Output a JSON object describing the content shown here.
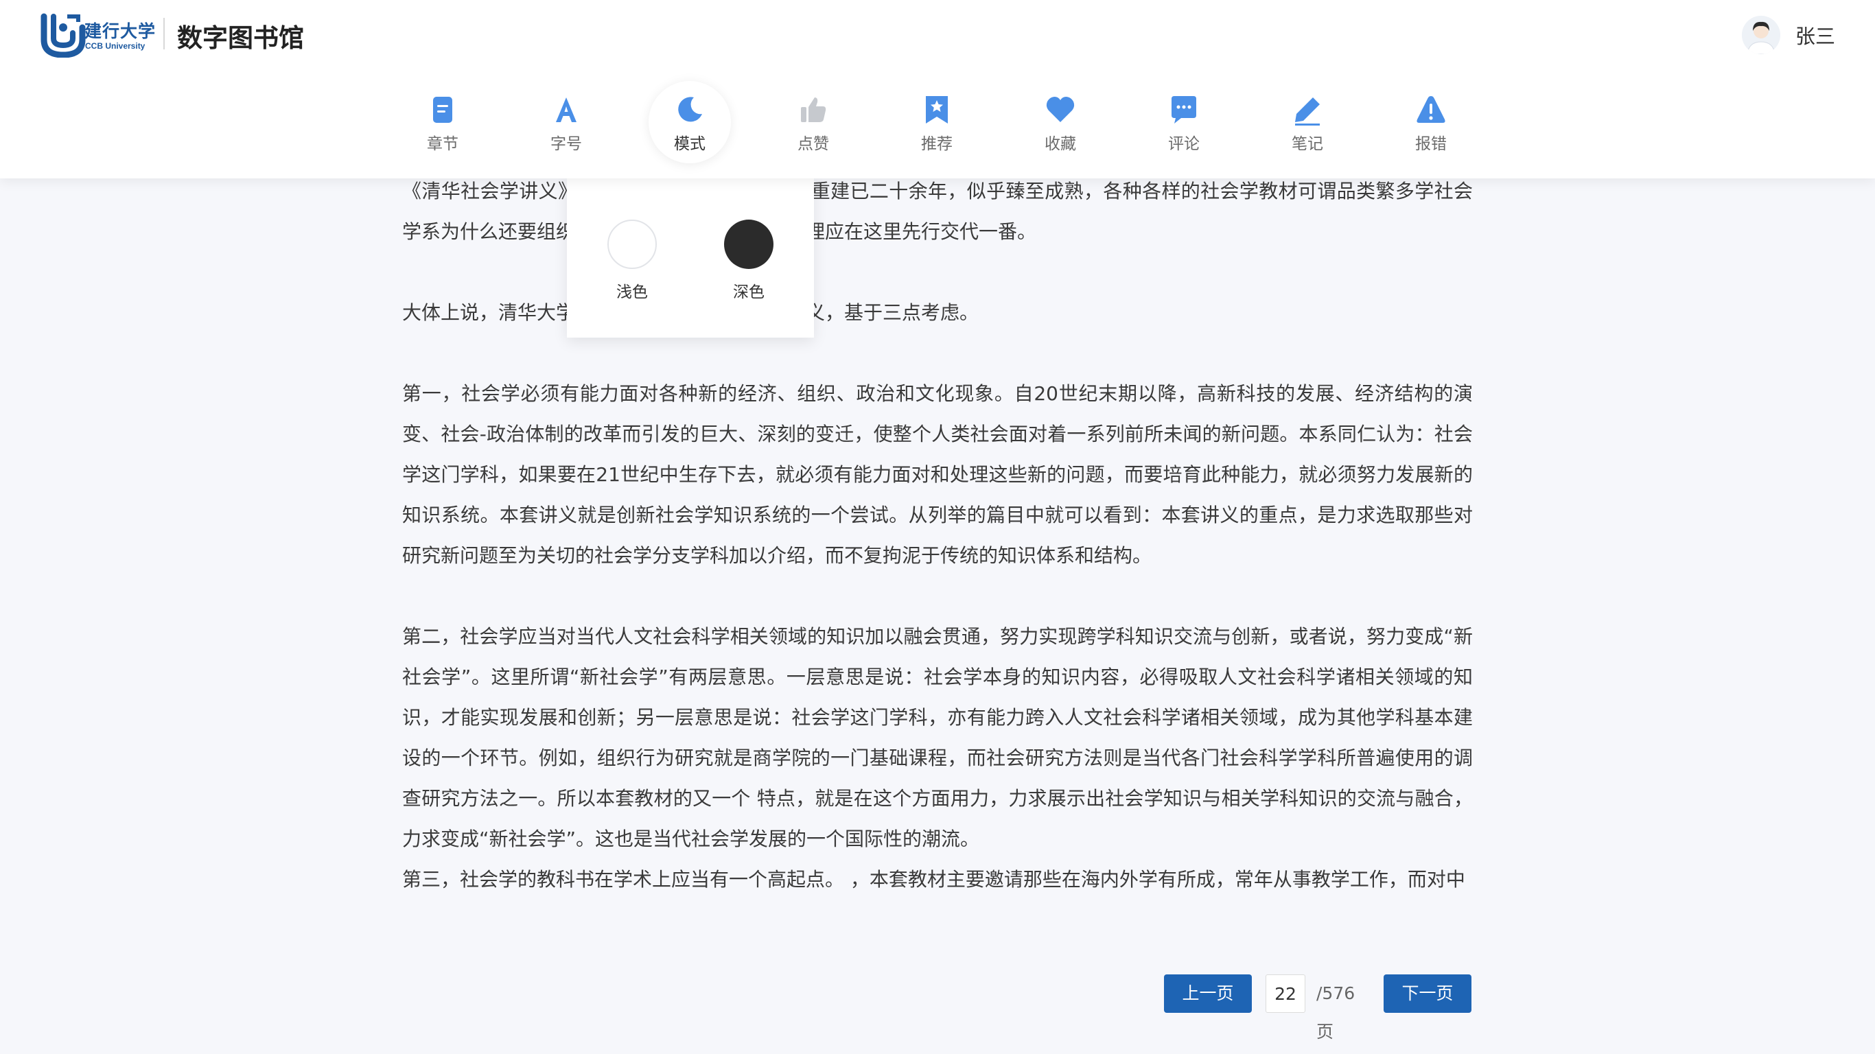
{
  "brand": {
    "logo_cn": "建行大学",
    "logo_en": "CCB University",
    "site_title": "数字图书馆"
  },
  "user": {
    "name": "张三"
  },
  "toolbar": {
    "items": [
      {
        "label": "章节",
        "icon": "chapter-icon"
      },
      {
        "label": "字号",
        "icon": "font-size-icon"
      },
      {
        "label": "模式",
        "icon": "moon-icon",
        "active": true
      },
      {
        "label": "点赞",
        "icon": "thumbs-up-icon"
      },
      {
        "label": "推荐",
        "icon": "bookmark-star-icon"
      },
      {
        "label": "收藏",
        "icon": "heart-icon"
      },
      {
        "label": "评论",
        "icon": "comment-icon"
      },
      {
        "label": "笔记",
        "icon": "pencil-icon"
      },
      {
        "label": "报错",
        "icon": "warning-icon"
      }
    ]
  },
  "mode_popup": {
    "light_label": "浅色",
    "dark_label": "深色"
  },
  "content": {
    "paragraphs": [
      "《清华社会学讲义》世了。在我国社会学恢复、重建已二十余年，似乎臻至成熟，各种各样的社会学教材可谓品类繁多学社会学系为什么还要组织这样一套讲义并付诸出版，理应在这里先行交代一番。",
      "大体上说，清华大学社会学系诸同仁筹办这套讲义，基于三点考虑。",
      "第一，社会学必须有能力面对各种新的经济、组织、政治和文化现象。自20世纪末期以降，高新科技的发展、经济结构的演变、社会-政治体制的改革而引发的巨大、深刻的变迁，使整个人类社会面对着一系列前所未闻的新问题。本系同仁认为：社会学这门学科，如果要在21世纪中生存下去，就必须有能力面对和处理这些新的问题，而要培育此种能力，就必须努力发展新的知识系统。本套讲义就是创新社会学知识系统的一个尝试。从列举的篇目中就可以看到：本套讲义的重点，是力求选取那些对研究新问题至为关切的社会学分支学科加以介绍，而不复拘泥于传统的知识体系和结构。",
      "第二，社会学应当对当代人文社会科学相关领域的知识加以融会贯通，努力实现跨学科知识交流与创新，或者说，努力变成“新社会学”。这里所谓“新社会学”有两层意思。一层意思是说：社会学本身的知识内容，必得吸取人文社会科学诸相关领域的知识，才能实现发展和创新；另一层意思是说：社会学这门学科，亦有能力跨入人文社会科学诸相关领域，成为其他学科基本建设的一个环节。例如，组织行为研究就是商学院的一门基础课程，而社会研究方法则是当代各门社会科学学科所普遍使用的调查研究方法之一。所以本套教材的又一个 特点，就是在这个方面用力，力求展示出社会学知识与相关学科知识的交流与融合，力求变成“新社会学”。这也是当代社会学发展的一个国际性的潮流。",
      "第三，社会学的教科书在学术上应当有一个高起点。 ，本套教材主要邀请那些在海内外学有所成，常年从事教学工作，而对中"
    ]
  },
  "pagination": {
    "prev_label": "上一页",
    "current_page": "22",
    "total_label": "/576页",
    "next_label": "下一页"
  },
  "colors": {
    "accent": "#1e64b4",
    "icon_blue": "#4a8fe7",
    "icon_gray": "#c6c9ce",
    "dark_mode_swatch": "#2b2b2b"
  }
}
